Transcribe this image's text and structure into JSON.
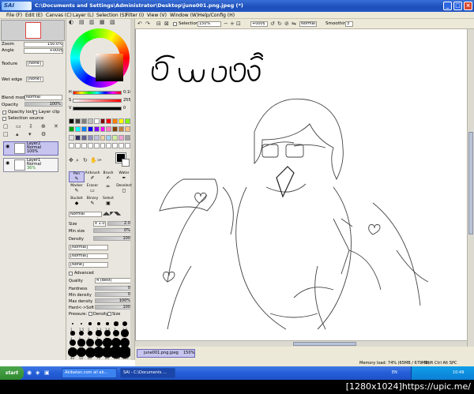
{
  "window": {
    "app_logo": "SAI",
    "title": "C:\\Documents and Settings\\Administrator\\Desktop\\june001.png.jpeg (*)"
  },
  "menu": [
    "File (F)",
    "Edit (E)",
    "Canvas (C)",
    "Layer (L)",
    "Selection (S)",
    "Filter (I)",
    "View (V)",
    "Window (W)",
    "Help/Config (H)"
  ],
  "navigator": {
    "zoom_label": "Zoom",
    "zoom_value": "150.0%",
    "angle_label": "Angle",
    "angle_value": "+000§"
  },
  "layer_props": {
    "texture_label": "Texture",
    "texture_value": "[None]",
    "wet_edge_label": "Wet edge",
    "wet_edge_value": "[None]",
    "blend_mode_label": "Blend mode",
    "blend_mode_value": "Normal",
    "opacity_label": "Opacity",
    "opacity_value": "100%",
    "opacity_lock": "Opacity lock",
    "layer_clip": "Layer clip",
    "selection_source": "Selection source"
  },
  "layers": [
    {
      "name": "Layer2",
      "mode": "Normal",
      "opacity": "100%"
    },
    {
      "name": "Layer1",
      "mode": "Normal",
      "opacity": "36%"
    }
  ],
  "color": {
    "h_label": "H",
    "h_value": "0:104",
    "s_label": "S",
    "s_value": "255",
    "v_label": "V",
    "v_value": "0"
  },
  "swatches": [
    "#000000",
    "#404040",
    "#808080",
    "#c0c0c0",
    "#ffffff",
    "#7f0000",
    "#ff0000",
    "#ff8000",
    "#ffff00",
    "#80ff00",
    "#00a000",
    "#00ffff",
    "#0080ff",
    "#0000ff",
    "#8000ff",
    "#ff00ff",
    "#ff80c0",
    "#804000",
    "#c08040",
    "#ffc080",
    "#e0e0e0",
    "#303060",
    "#606090",
    "#9090c0",
    "#c0c0e0",
    "#f0d0a0",
    "#a0d0f0",
    "#d0f0a0",
    "#f0a0d0",
    "#a0a0a0",
    "#ffffff",
    "#ffffff",
    "#ffffff",
    "#ffffff",
    "#ffffff",
    "#ffffff",
    "#ffffff",
    "#ffffff",
    "#ffffff",
    "#ffffff"
  ],
  "tools": [
    {
      "label": "Pen",
      "glyph": "✎"
    },
    {
      "label": "Airbrush",
      "glyph": "✐"
    },
    {
      "label": "Brush",
      "glyph": "✍"
    },
    {
      "label": "Water",
      "glyph": "✒"
    },
    {
      "label": "Marker",
      "glyph": "✎"
    },
    {
      "label": "Eraser",
      "glyph": "▭"
    },
    {
      "label": "",
      "glyph": "✏"
    },
    {
      "label": "Deselect",
      "glyph": "◻"
    },
    {
      "label": "Bucket",
      "glyph": "◆"
    },
    {
      "label": "Binary",
      "glyph": "✎"
    },
    {
      "label": "Select",
      "glyph": "▣"
    },
    {
      "label": "",
      "glyph": ""
    }
  ],
  "brush": {
    "mode": "Normal",
    "size_label": "Size",
    "size_mult": "x 1.0",
    "size_value": "2.0",
    "min_size_label": "Min size",
    "min_size_value": "0%",
    "density_label": "Density",
    "density_value": "100",
    "shape1": "[Normal]",
    "shape2": "[Normal]",
    "shape3": "[None]",
    "advanced_label": "Advanced",
    "quality_label": "Quality",
    "quality_value": "4 (Best)",
    "hardness_label": "Hardness",
    "hardness_value": "0",
    "min_density_label": "Min density",
    "min_density_value": "0",
    "max_density_label": "Max density",
    "max_density_value": "100%",
    "hard_soft_label": "Hard<->Soft",
    "hard_soft_value": "100",
    "pressure_label": "Pressure:",
    "density_chk": "Density",
    "size_chk": "Size"
  },
  "brush_sizes": [
    "1",
    "1.5",
    "2",
    "2.3",
    "2.6",
    "3",
    "3.5",
    "4",
    "5",
    "6",
    "7",
    "8",
    "9",
    "10",
    "12",
    "14",
    "16",
    "20",
    "25",
    "30",
    "35",
    "40",
    "50",
    "60",
    "70",
    "80",
    "100",
    "120"
  ],
  "canvas_toolbar": {
    "selection_label": "Selection",
    "zoom": "150%",
    "angle": "+000§",
    "mode": "Normal",
    "smoothing_label": "Smoothing",
    "smoothing_value": "3"
  },
  "document_tab": {
    "name": "june001.png.jpeg",
    "zoom": "150%"
  },
  "status": {
    "memory": "Memory load: 74% (65MB / 679MB)",
    "keys": "Shift Ctrl Alt SPC"
  },
  "taskbar": {
    "start": "start",
    "tasks": [
      "Akibatan.com all ab...",
      "SAI - C:\\Documents ..."
    ],
    "lang": "EN",
    "clock": "10:49"
  },
  "footer": "[1280x1024]https://upic.me/"
}
